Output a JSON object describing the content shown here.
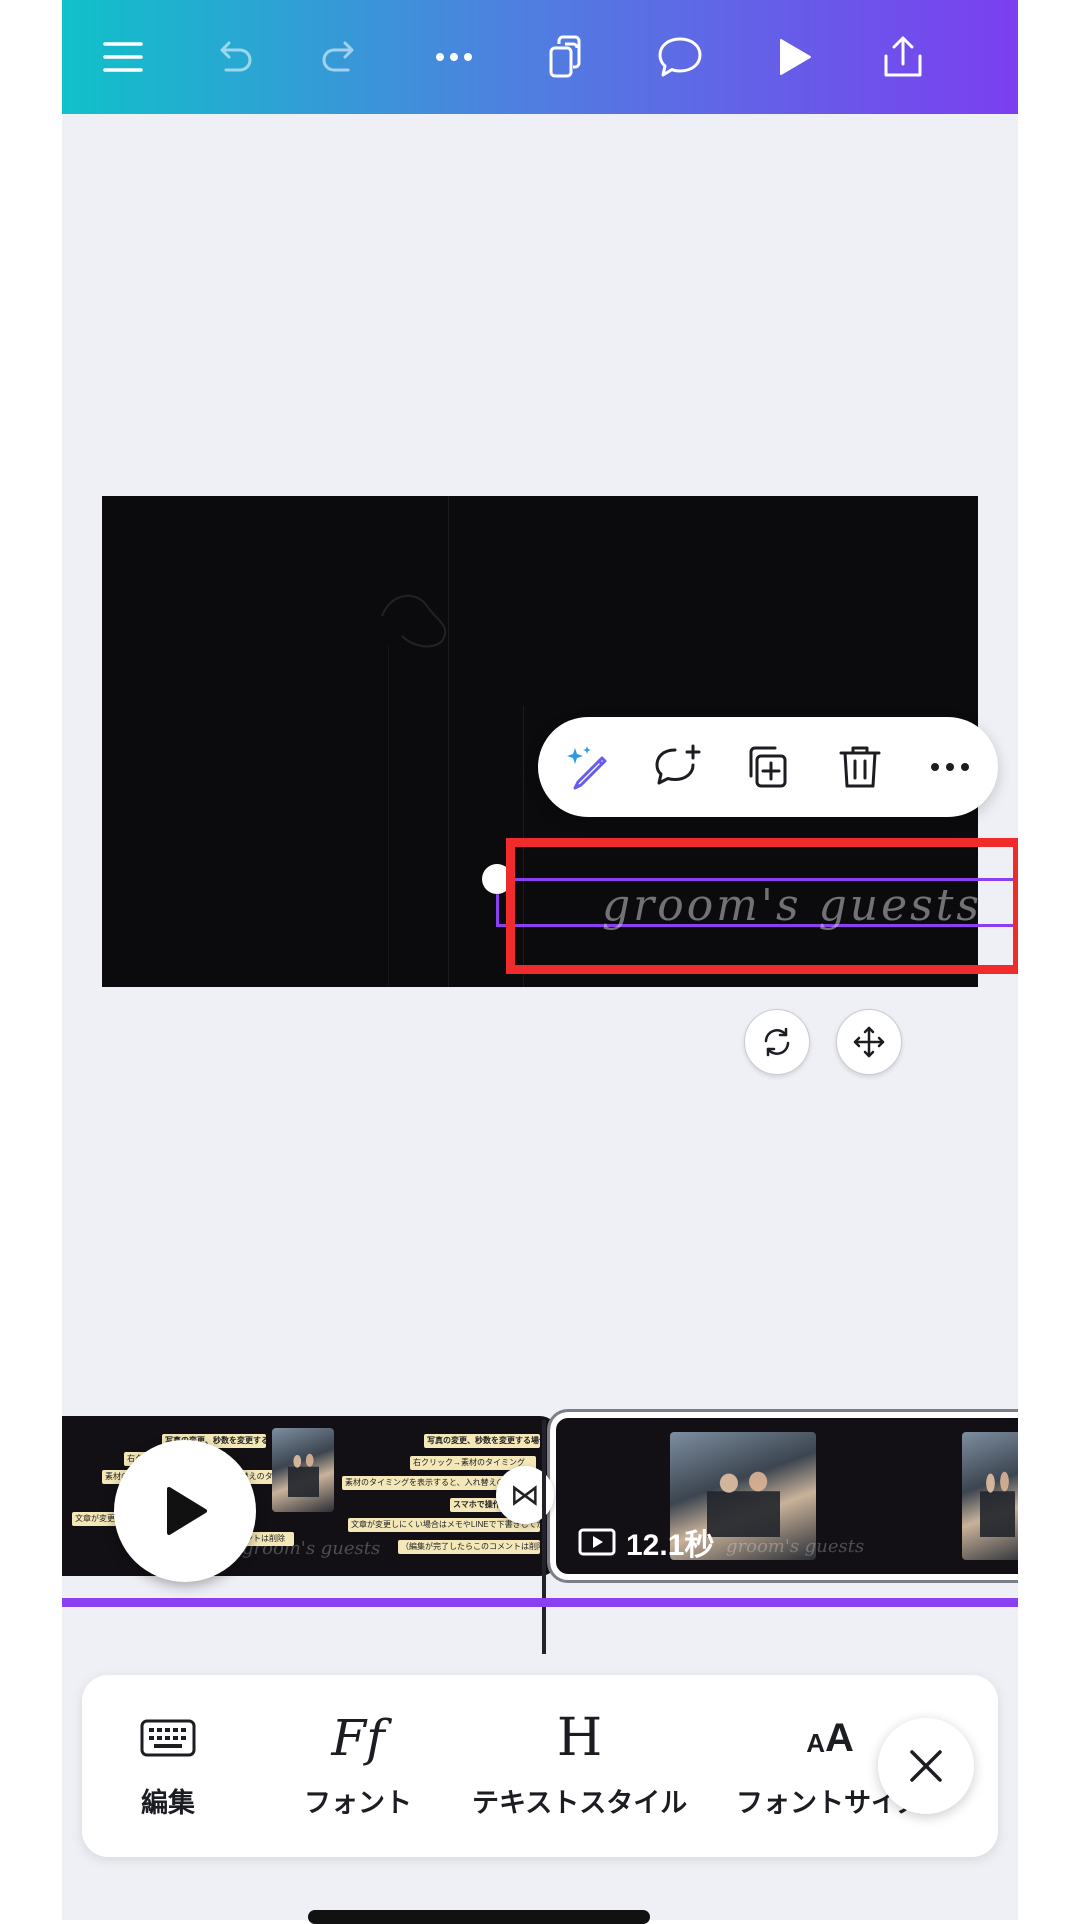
{
  "toolbar": {
    "items": [
      {
        "name": "menu-icon"
      },
      {
        "name": "undo-icon"
      },
      {
        "name": "redo-icon"
      },
      {
        "name": "more-icon"
      },
      {
        "name": "pages-icon"
      },
      {
        "name": "comment-icon"
      },
      {
        "name": "play-icon"
      },
      {
        "name": "share-icon"
      }
    ],
    "gradient": [
      "#10c1c9",
      "#7b3ff0"
    ]
  },
  "canvas": {
    "selected_text": "groom's guests",
    "selection_color": "#8a3ff0",
    "highlight_color": "#ef2b2b"
  },
  "context_menu": {
    "items": [
      "magic-edit-icon",
      "add-comment-icon",
      "duplicate-icon",
      "delete-icon",
      "more-icon"
    ]
  },
  "controls": {
    "items": [
      "rotate-icon",
      "move-icon"
    ]
  },
  "timeline": {
    "clip_a": {
      "notes": [
        "写真の変更、秒数を変更する場合",
        "右クリック→素材のタイミング",
        "素材のタイミングを表示すると、入れ替えのタイミング",
        "スマホで操作中の方",
        "文章が変更しにくい場合はメモやLINEで下書きしてから",
        "（編集が完了したらこのコメントは削除"
      ],
      "caption": "groom's guests"
    },
    "clip_b": {
      "duration": "12.1秒",
      "caption": "groom's guests"
    },
    "transition_icon": "⋈"
  },
  "bottom_tools": [
    {
      "id": "edit",
      "label": "編集",
      "icon": "keyboard-icon"
    },
    {
      "id": "font",
      "label": "フォント",
      "icon": "font-icon",
      "glyph": "Ff"
    },
    {
      "id": "text-style",
      "label": "テキストスタイル",
      "icon": "text-style-icon",
      "glyph": "H"
    },
    {
      "id": "font-size",
      "label": "フォントサイズ",
      "icon": "font-size-icon",
      "glyph": "AA"
    }
  ]
}
